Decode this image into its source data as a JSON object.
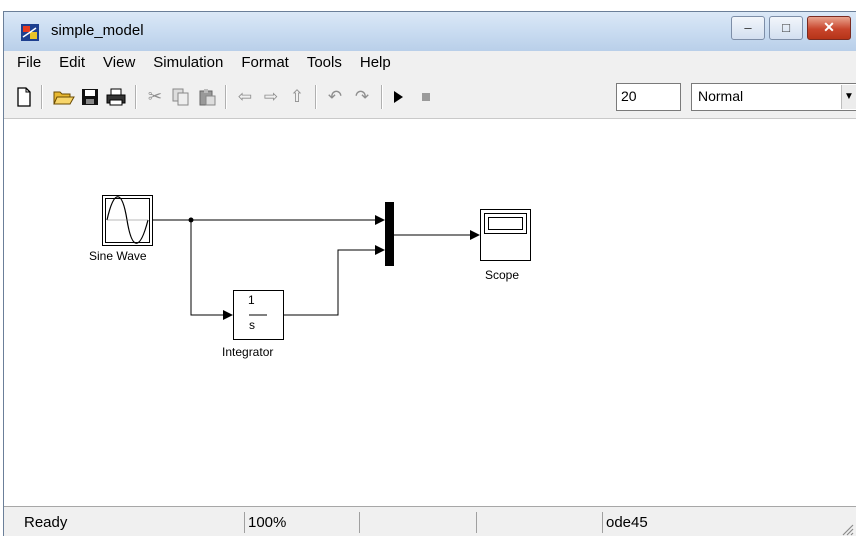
{
  "window": {
    "title": "simple_model",
    "controls": {
      "minimize_glyph": "–",
      "maximize_glyph": "□",
      "close_glyph": "✕"
    }
  },
  "menu": [
    "File",
    "Edit",
    "View",
    "Simulation",
    "Format",
    "Tools",
    "Help"
  ],
  "toolbar": {
    "stop_time": "20",
    "sim_mode": "Normal",
    "icons": [
      "new-model-icon",
      "open-folder-icon",
      "save-icon",
      "print-icon",
      "cut-icon",
      "copy-icon",
      "paste-icon",
      "back-arrow-icon",
      "forward-arrow-icon",
      "up-arrow-icon",
      "undo-icon",
      "redo-icon",
      "run-icon",
      "stop-icon"
    ]
  },
  "blocks": {
    "sine_wave": {
      "label": "Sine Wave"
    },
    "integrator": {
      "label": "Integrator",
      "numerator": "1",
      "denominator": "s"
    },
    "scope": {
      "label": "Scope"
    }
  },
  "status": {
    "state": "Ready",
    "zoom": "100%",
    "pane3": "",
    "pane4": "",
    "solver": "ode45"
  },
  "colors": {
    "titlebar": "#c9dcf1",
    "close_button": "#c8452c",
    "canvas": "#ffffff"
  }
}
